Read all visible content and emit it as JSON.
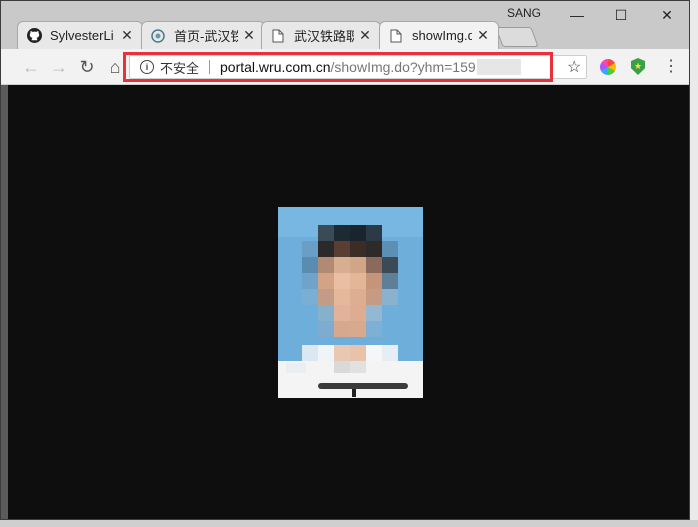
{
  "window": {
    "profile_name": "SANG",
    "minimize": "—",
    "maximize": "☐",
    "close": "✕"
  },
  "tabs": [
    {
      "title": "SylvesterLi",
      "icon": "github-icon",
      "close": "✕",
      "active": false
    },
    {
      "title": "首页-武汉铁",
      "icon": "globe-icon",
      "close": "✕",
      "active": false
    },
    {
      "title": "武汉铁路职",
      "icon": "page-icon",
      "close": "✕",
      "active": false
    },
    {
      "title": "showImg.d",
      "icon": "page-icon",
      "close": "✕",
      "active": true
    }
  ],
  "toolbar": {
    "back": "←",
    "forward": "→",
    "reload": "↻",
    "home": "⌂",
    "security_label": "不安全",
    "url_host": "portal.wru.com.cn",
    "url_path": "/showImg.do?yhm=159",
    "bookmark": "☆",
    "menu": "⋮"
  },
  "colors": {
    "highlight": "#e8313b",
    "content_background": "#0e0e0e",
    "photo_background": "#6dafd9"
  }
}
